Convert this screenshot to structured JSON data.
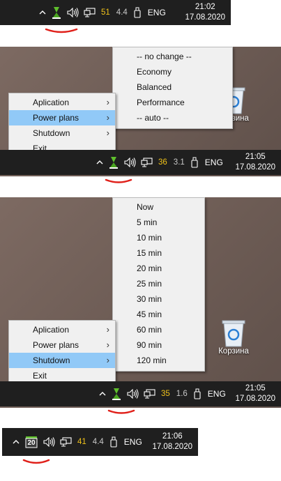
{
  "tray_1": {
    "temp": "51",
    "load": "4.4",
    "lang": "ENG",
    "time": "21:02",
    "date": "17.08.2020"
  },
  "tray_2": {
    "temp": "36",
    "load": "3.1",
    "lang": "ENG",
    "time": "21:05",
    "date": "17.08.2020"
  },
  "tray_3": {
    "temp": "35",
    "load": "1.6",
    "lang": "ENG",
    "time": "21:05",
    "date": "17.08.2020"
  },
  "tray_4": {
    "temp": "41",
    "load": "4.4",
    "lang": "ENG",
    "time": "21:06",
    "date": "17.08.2020",
    "icon_number": "20"
  },
  "context_menu": {
    "items": [
      "Aplication",
      "Power plans",
      "Shutdown",
      "Exit"
    ]
  },
  "power_plans_submenu": {
    "items": [
      "-- no change --",
      "Economy",
      "Balanced",
      "Performance",
      "-- auto --"
    ]
  },
  "shutdown_submenu": {
    "items": [
      "Now",
      "5 min",
      "10 min",
      "15 min",
      "20 min",
      "25 min",
      "30 min",
      "45 min",
      "60 min",
      "90 min",
      "120 min"
    ]
  },
  "desktop": {
    "recycle_bin_label": "Корзина"
  },
  "colors": {
    "taskbar": "#1f1f1f",
    "highlight": "#91c9f7",
    "temp_yellow": "#f0c21a",
    "underline_red": "#e0201a",
    "menu_bg": "#f0f0f0"
  },
  "icons": [
    "chevron-up-icon",
    "battery-status-icon",
    "speaker-icon",
    "monitor-icon",
    "usb-drive-icon",
    "recycle-bin-icon",
    "submenu-arrow-icon"
  ]
}
